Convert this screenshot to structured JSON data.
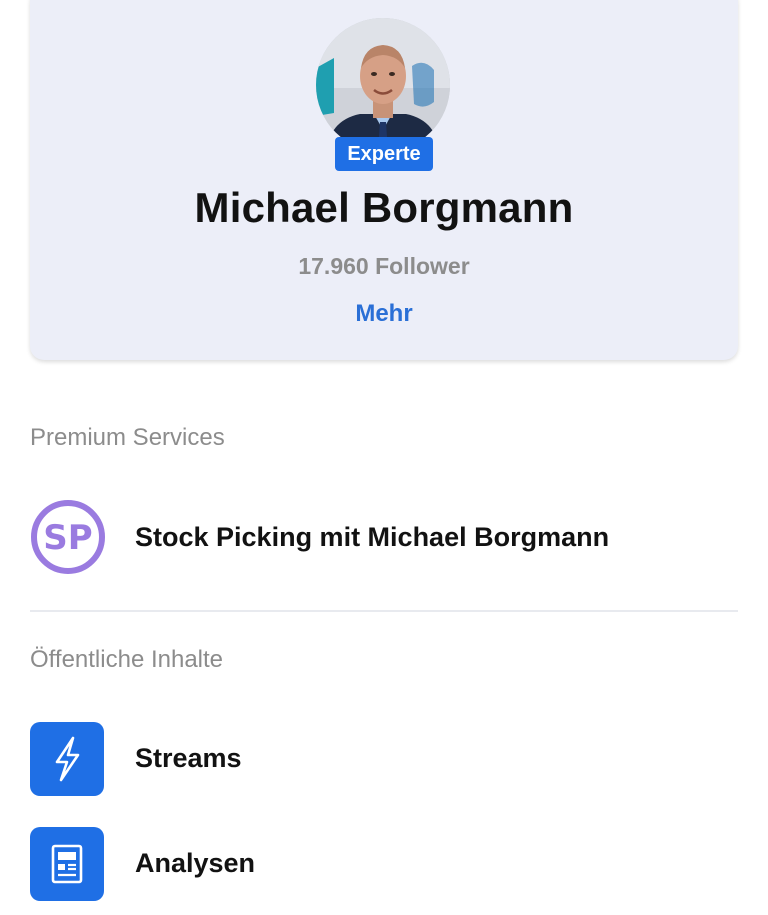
{
  "profile": {
    "badge": "Experte",
    "name": "Michael Borgmann",
    "followers": "17.960 Follower",
    "more_label": "Mehr"
  },
  "premium": {
    "heading": "Premium Services",
    "items": [
      {
        "logo_text": "SP",
        "label": "Stock Picking mit Michael Borgmann",
        "icon": "sp-logo-icon"
      }
    ]
  },
  "public": {
    "heading": "Öffentliche Inhalte",
    "items": [
      {
        "label": "Streams",
        "icon": "lightning-icon"
      },
      {
        "label": "Analysen",
        "icon": "article-icon"
      }
    ]
  },
  "colors": {
    "accent": "#1f6fe5",
    "link": "#2a6fd6",
    "card_background": "#eceef8",
    "sp_purple": "#9a7be0"
  }
}
